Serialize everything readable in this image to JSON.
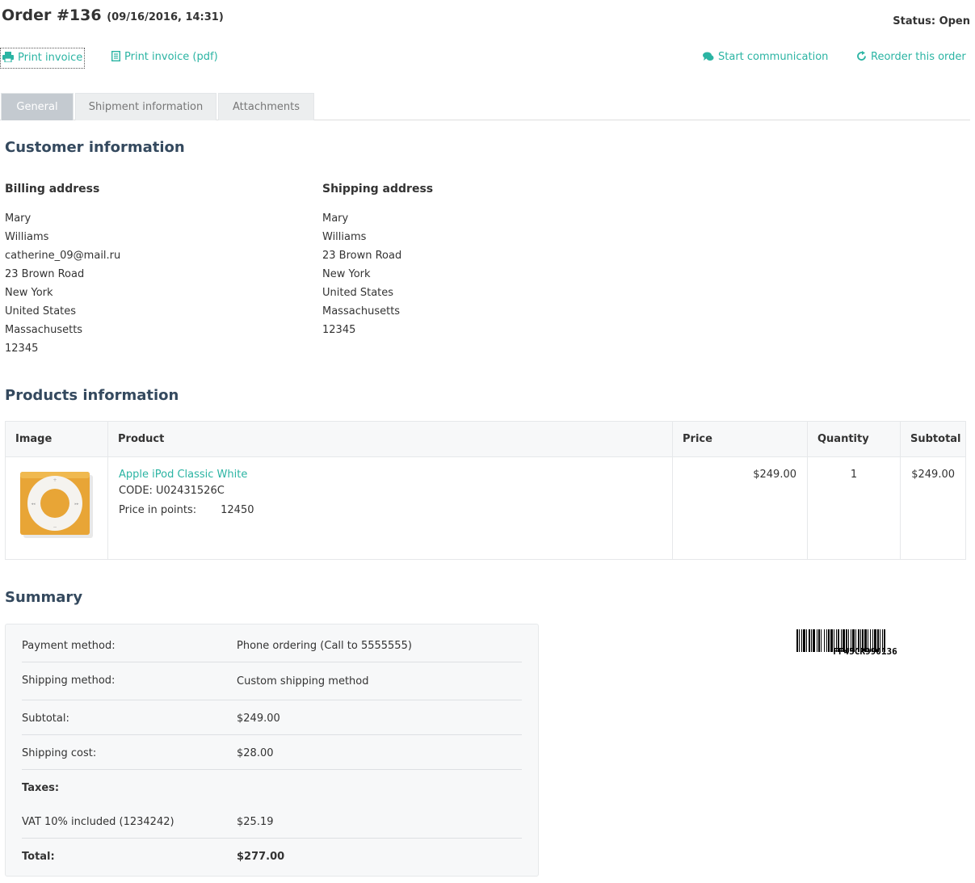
{
  "order": {
    "title": "Order #136",
    "date": "(09/16/2016, 14:31)",
    "status": "Status: Open"
  },
  "actions": {
    "print_invoice": "Print invoice",
    "print_invoice_pdf": "Print invoice (pdf)",
    "start_communication": "Start communication",
    "reorder": "Reorder this order"
  },
  "tabs": [
    {
      "label": "General",
      "active": true
    },
    {
      "label": "Shipment information",
      "active": false
    },
    {
      "label": "Attachments",
      "active": false
    }
  ],
  "customer": {
    "heading": "Customer information",
    "billing": {
      "title": "Billing address",
      "lines": [
        "Mary",
        "Williams",
        "catherine_09@mail.ru",
        "23 Brown Road",
        "New York",
        "United States",
        "Massachusetts",
        "12345"
      ]
    },
    "shipping": {
      "title": "Shipping address",
      "lines": [
        "Mary",
        "Williams",
        "23 Brown Road",
        "New York",
        "United States",
        "Massachusetts",
        "12345"
      ]
    }
  },
  "products": {
    "heading": "Products information",
    "columns": [
      "Image",
      "Product",
      "Price",
      "Quantity",
      "Subtotal"
    ],
    "rows": [
      {
        "name": "Apple iPod Classic White",
        "code": "CODE: U02431526C",
        "points_label": "Price in points:",
        "points_value": "12450",
        "price": "$249.00",
        "quantity": "1",
        "subtotal": "$249.00"
      }
    ]
  },
  "summary": {
    "heading": "Summary",
    "payment_label": "Payment method:",
    "payment_value": "Phone ordering (Call to 5555555)",
    "shipping_label": "Shipping method:",
    "shipping_value": "Custom shipping method",
    "subtotal_label": "Subtotal:",
    "subtotal_value": "$249.00",
    "shipping_cost_label": "Shipping cost:",
    "shipping_cost_value": "$28.00",
    "taxes_label": "Taxes:",
    "vat_label": "VAT 10% included (1234242)",
    "vat_value": "$25.19",
    "total_label": "Total:",
    "total_value": "$277.00"
  },
  "barcode": {
    "text": "FF45CR990136"
  },
  "colors": {
    "accent": "#2bb4a3",
    "heading": "#34495e",
    "tab_active": "#c4cad0",
    "product_orange": "#e8a536"
  }
}
